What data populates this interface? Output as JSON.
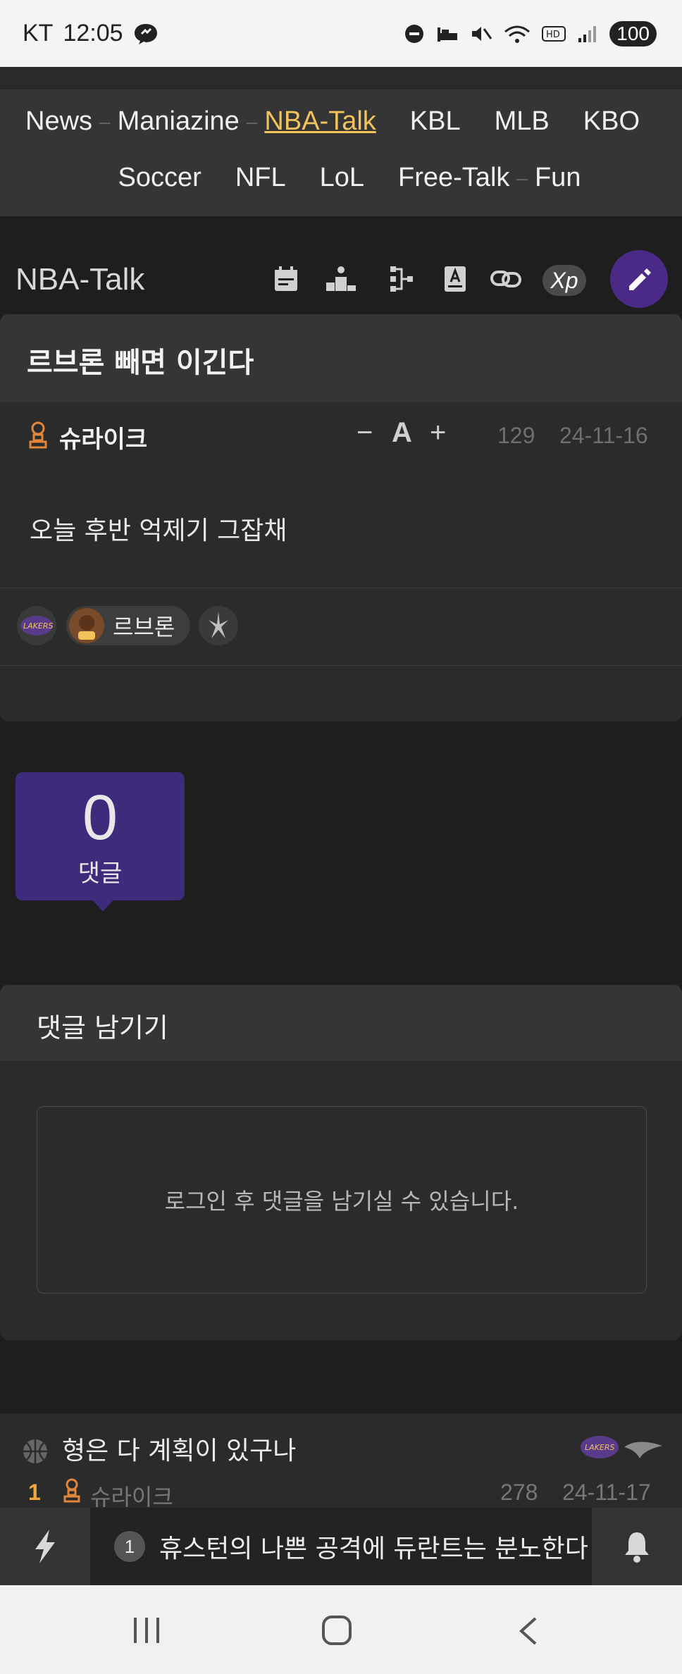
{
  "status_bar": {
    "carrier": "KT",
    "time": "12:05",
    "battery": "100"
  },
  "nav": {
    "row1": [
      "News",
      "Maniazine",
      "NBA-Talk",
      "KBL",
      "MLB",
      "KBO"
    ],
    "row2": [
      "Soccer",
      "NFL",
      "LoL",
      "Free-Talk",
      "Fun"
    ],
    "active": "NBA-Talk"
  },
  "board": {
    "title": "NBA-Talk",
    "tools": [
      "calendar-icon",
      "podium-icon",
      "bracket-icon",
      "book-icon",
      "link-icon"
    ],
    "xp_label": "Xp"
  },
  "post": {
    "title": "르브론 빼면 이긴다",
    "author": "슈라이크",
    "font_controls": [
      "−",
      "A",
      "+"
    ],
    "views": "129",
    "date": "24-11-16",
    "content": "오늘 후반 억제기 그잡채",
    "player_tag": "르브론"
  },
  "comments": {
    "count": "0",
    "label": "댓글"
  },
  "reply": {
    "heading": "댓글 남기기",
    "login_notice": "로그인 후 댓글을 남기실 수 있습니다."
  },
  "next_post": {
    "title": "형은 다 계획이 있구나",
    "rank": "1",
    "author": "슈라이크",
    "views": "278",
    "date": "24-11-17"
  },
  "ticker": {
    "index": "1",
    "text": "휴스턴의 나쁜 공격에 듀란트는 분노한다"
  },
  "colors": {
    "accent": "#3e2b7c",
    "active_nav": "#f1c35a",
    "rank": "#f1a53a"
  }
}
